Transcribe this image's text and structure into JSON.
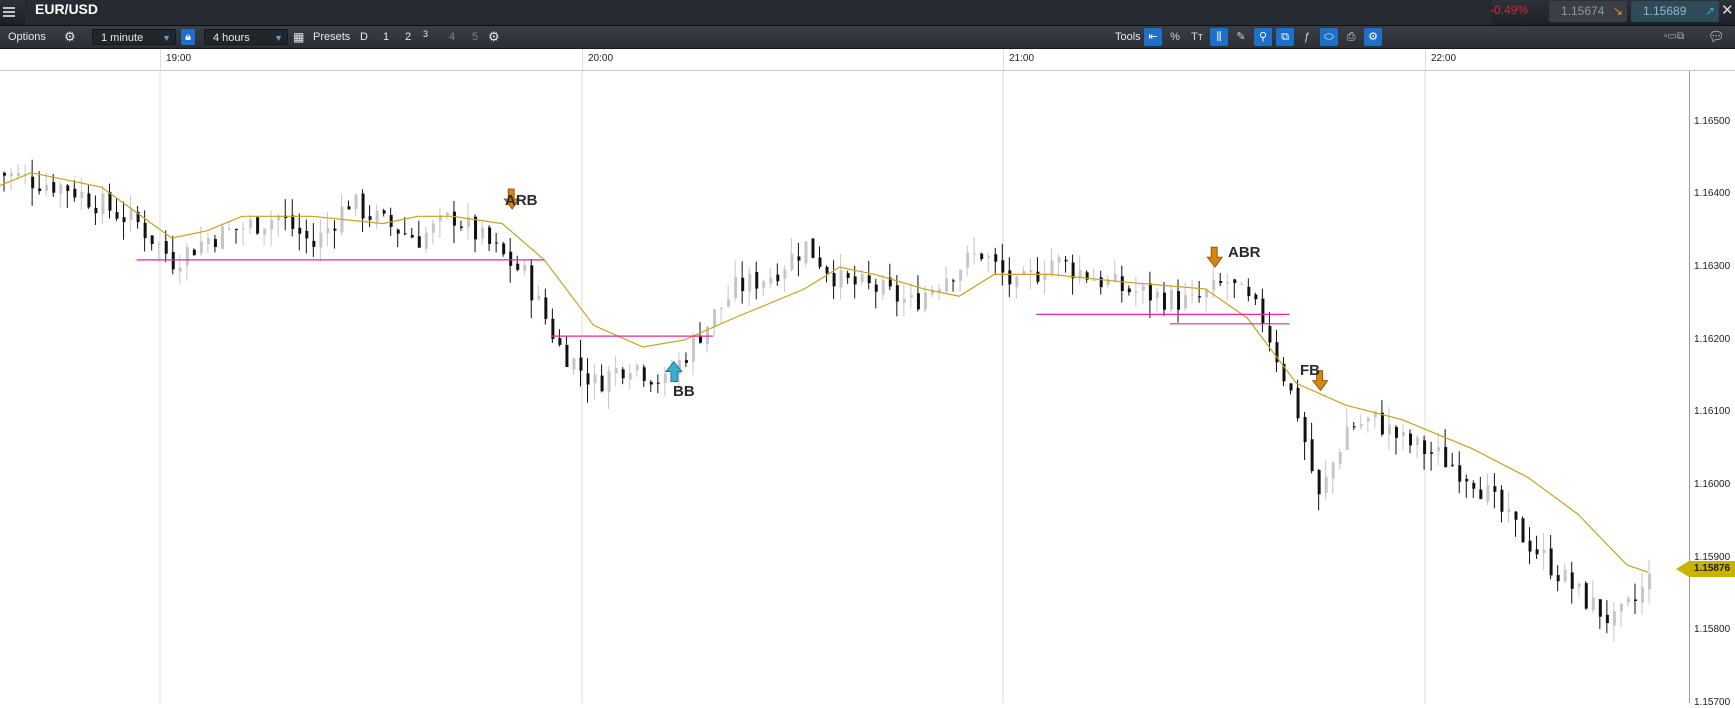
{
  "header": {
    "symbol": "EUR/USD",
    "change_pct": "-0.49%",
    "bid": "1.15674",
    "ask": "1.15689",
    "bid_arrow": "↘",
    "ask_arrow": "↗",
    "close_glyph": "✕"
  },
  "toolbar": {
    "options_label": "Options",
    "interval": "1 minute",
    "range": "4 hours",
    "presets_label": "Presets",
    "presets": [
      "D",
      "1",
      "2",
      "3",
      "4",
      "5"
    ],
    "tools_label": "Tools",
    "tools": [
      {
        "icon": "crosshair-back-icon",
        "glyph": "⇤",
        "active": true
      },
      {
        "icon": "percent-icon",
        "glyph": "%",
        "active": false
      },
      {
        "icon": "text-icon",
        "glyph": "Tт",
        "active": false
      },
      {
        "icon": "grid-lines-icon",
        "glyph": "⫼",
        "active": true
      },
      {
        "icon": "draw-icon",
        "glyph": "✎",
        "active": false
      },
      {
        "icon": "candle-icon",
        "glyph": "⚲",
        "active": true
      },
      {
        "icon": "layers-icon",
        "glyph": "⧉",
        "active": true
      },
      {
        "icon": "indicator-icon",
        "glyph": "ƒ",
        "active": false
      },
      {
        "icon": "tag-icon",
        "glyph": "⬭",
        "active": true
      },
      {
        "icon": "print-icon",
        "glyph": "⎙",
        "active": false
      },
      {
        "icon": "settings-icon",
        "glyph": "⚙",
        "active": true
      }
    ]
  },
  "time_axis": [
    "19:00",
    "20:00",
    "21:00",
    "22:00"
  ],
  "price_axis": [
    "1.16500",
    "1.16400",
    "1.16300",
    "1.16200",
    "1.16100",
    "1.16000",
    "1.15900",
    "1.15800",
    "1.15700"
  ],
  "last_price": "1.15876",
  "annotations": [
    {
      "label": "ARB",
      "marker": "down"
    },
    {
      "label": "BB",
      "marker": "up"
    },
    {
      "label": "ABR",
      "marker": "down"
    },
    {
      "label": "FB",
      "marker": "down"
    }
  ],
  "colors": {
    "ma_line": "#c8a21c",
    "level_lines": "#e0299c",
    "sell_marker": "#d9840b",
    "buy_marker": "#3aaed0",
    "price_tag": "#c8b400"
  },
  "chart_data": {
    "type": "candlestick",
    "interval": "1 minute",
    "range": "4 hours",
    "ylim": [
      1.157,
      1.1657
    ],
    "x_ticks": [
      "19:00",
      "20:00",
      "21:00",
      "22:00"
    ],
    "y_ticks": [
      1.165,
      1.164,
      1.163,
      1.162,
      1.161,
      1.16,
      1.159,
      1.158,
      1.157
    ],
    "close_series": [
      [
        0,
        1.1643
      ],
      [
        10,
        1.1641
      ],
      [
        20,
        1.1636
      ],
      [
        25,
        1.1631
      ],
      [
        30,
        1.1634
      ],
      [
        40,
        1.1637
      ],
      [
        45,
        1.1633
      ],
      [
        50,
        1.1639
      ],
      [
        55,
        1.1636
      ],
      [
        60,
        1.1634
      ],
      [
        65,
        1.1637
      ],
      [
        70,
        1.1633
      ],
      [
        75,
        1.1629
      ],
      [
        80,
        1.1619
      ],
      [
        85,
        1.1614
      ],
      [
        90,
        1.1617
      ],
      [
        95,
        1.1614
      ],
      [
        100,
        1.1621
      ],
      [
        105,
        1.1627
      ],
      [
        110,
        1.1629
      ],
      [
        115,
        1.1633
      ],
      [
        120,
        1.1628
      ],
      [
        125,
        1.1627
      ],
      [
        130,
        1.1625
      ],
      [
        135,
        1.1629
      ],
      [
        140,
        1.1632
      ],
      [
        145,
        1.1627
      ],
      [
        150,
        1.1631
      ],
      [
        155,
        1.1629
      ],
      [
        160,
        1.1627
      ],
      [
        165,
        1.1626
      ],
      [
        170,
        1.1625
      ],
      [
        175,
        1.1628
      ],
      [
        180,
        1.1623
      ],
      [
        185,
        1.161
      ],
      [
        188,
        1.1598
      ],
      [
        192,
        1.1608
      ],
      [
        196,
        1.1609
      ],
      [
        200,
        1.1606
      ],
      [
        205,
        1.1604
      ],
      [
        210,
        1.1601
      ],
      [
        215,
        1.1595
      ],
      [
        220,
        1.159
      ],
      [
        225,
        1.1585
      ],
      [
        230,
        1.1581
      ],
      [
        233,
        1.1584
      ],
      [
        235,
        1.1587
      ]
    ],
    "moving_average": [
      [
        0,
        1.1641
      ],
      [
        5,
        1.1643
      ],
      [
        15,
        1.1641
      ],
      [
        25,
        1.1634
      ],
      [
        30,
        1.1635
      ],
      [
        35,
        1.1637
      ],
      [
        45,
        1.1637
      ],
      [
        55,
        1.1636
      ],
      [
        60,
        1.1637
      ],
      [
        65,
        1.1637
      ],
      [
        72,
        1.1636
      ],
      [
        78,
        1.1631
      ],
      [
        85,
        1.1622
      ],
      [
        92,
        1.1619
      ],
      [
        98,
        1.162
      ],
      [
        105,
        1.1623
      ],
      [
        110,
        1.1625
      ],
      [
        115,
        1.1627
      ],
      [
        120,
        1.163
      ],
      [
        125,
        1.1629
      ],
      [
        132,
        1.1627
      ],
      [
        137,
        1.1626
      ],
      [
        142,
        1.1629
      ],
      [
        150,
        1.1629
      ],
      [
        160,
        1.1628
      ],
      [
        172,
        1.1627
      ],
      [
        178,
        1.1623
      ],
      [
        185,
        1.1614
      ],
      [
        192,
        1.1611
      ],
      [
        200,
        1.1609
      ],
      [
        210,
        1.1605
      ],
      [
        218,
        1.1601
      ],
      [
        225,
        1.1596
      ],
      [
        232,
        1.1589
      ],
      [
        235,
        1.1588
      ]
    ],
    "levels": [
      {
        "from": 20,
        "to": 78,
        "price": 1.1631
      },
      {
        "from": 79,
        "to": 102,
        "price": 1.16205
      },
      {
        "from": 148,
        "to": 184,
        "price": 1.16235
      },
      {
        "from": 167,
        "to": 184,
        "price": 1.16222
      }
    ],
    "signals": [
      {
        "label": "ARB",
        "minute": 73,
        "price": 1.1638,
        "direction": "down"
      },
      {
        "label": "BB",
        "minute": 96,
        "price": 1.1617,
        "direction": "up"
      },
      {
        "label": "ABR",
        "minute": 173,
        "price": 1.163,
        "direction": "down"
      },
      {
        "label": "FB",
        "minute": 188,
        "price": 1.1613,
        "direction": "down"
      }
    ],
    "last_price": 1.15876
  }
}
